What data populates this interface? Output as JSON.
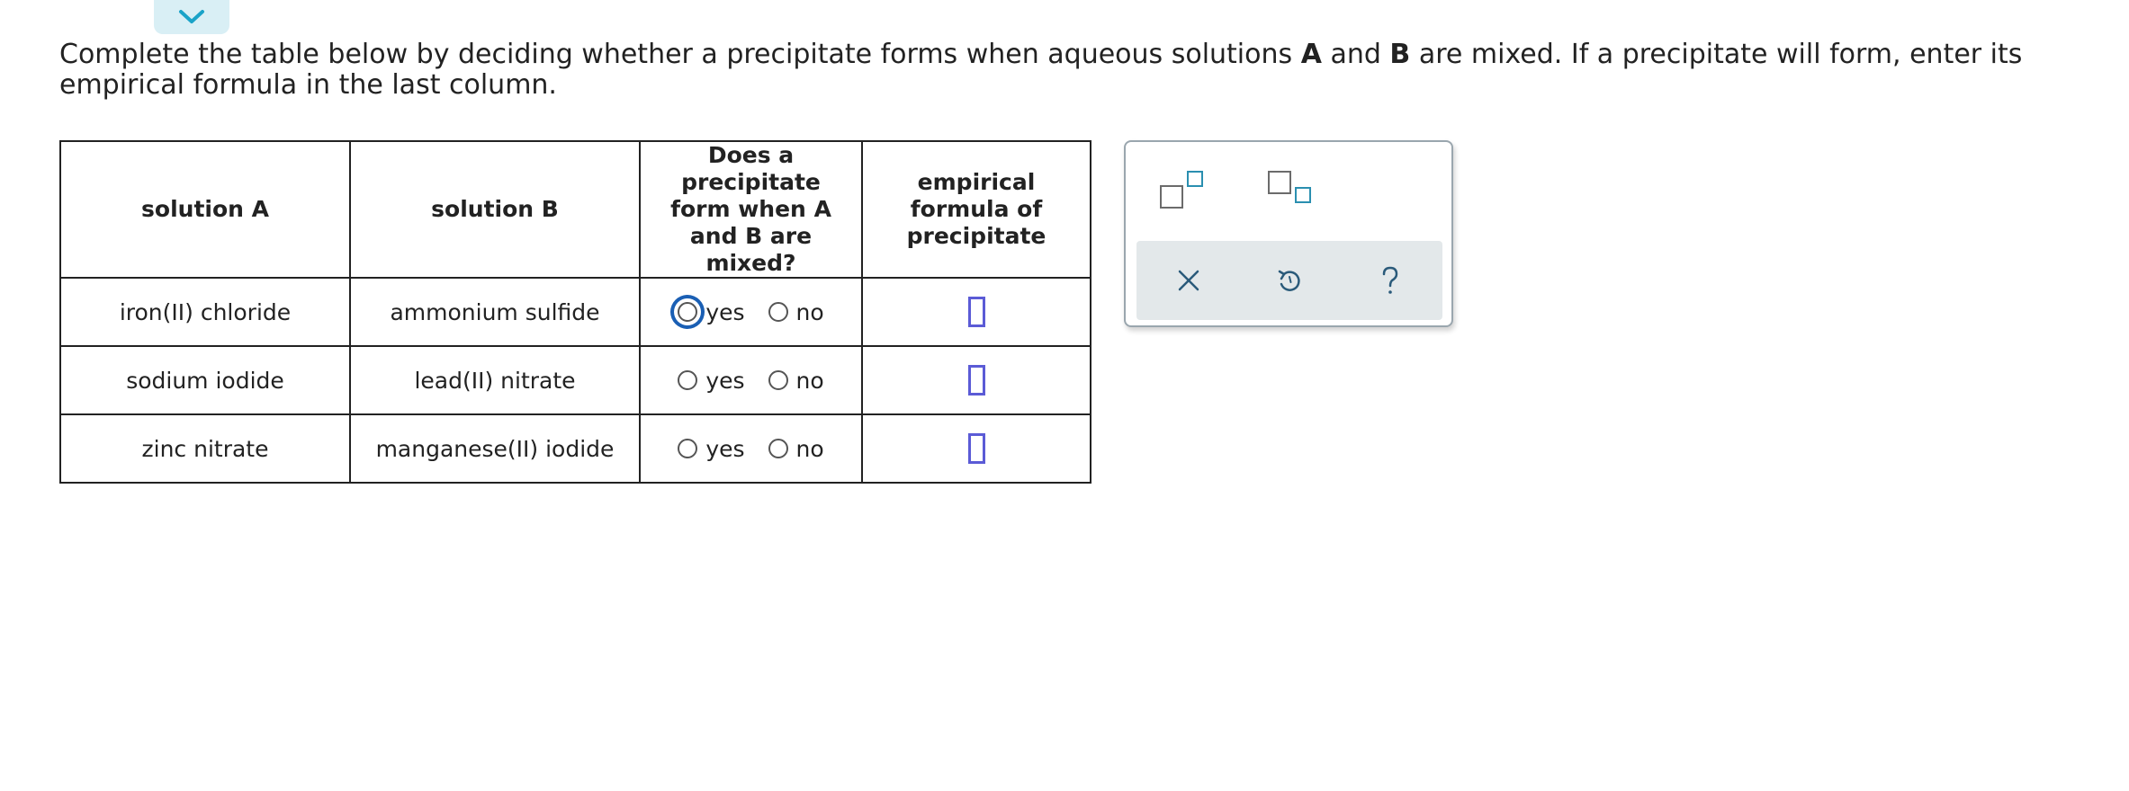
{
  "instructions": {
    "part1": "Complete the table below by deciding whether a precipitate forms when aqueous solutions ",
    "bold_a": "A",
    "part2": " and ",
    "bold_b": "B",
    "part3": " are mixed. If a precipitate will form, enter its empirical formula in the last column."
  },
  "table": {
    "headers": {
      "solution_a": "solution A",
      "solution_b": "solution B",
      "precipitate_q": "Does a precipitate form when A and B are mixed?",
      "formula": "empirical formula of precipitate"
    },
    "rows": [
      {
        "solution_a": "iron(II) chloride",
        "solution_b": "ammonium sulfide",
        "yes": "yes",
        "no": "no"
      },
      {
        "solution_a": "sodium iodide",
        "solution_b": "lead(II) nitrate",
        "yes": "yes",
        "no": "no"
      },
      {
        "solution_a": "zinc nitrate",
        "solution_b": "manganese(II) iodide",
        "yes": "yes",
        "no": "no"
      }
    ]
  },
  "palette": {
    "templates": [
      "superscript-template-icon",
      "subscript-template-icon"
    ],
    "actions": [
      "clear-icon",
      "undo-icon",
      "help-icon"
    ],
    "accent_color": "#2a8fb0"
  },
  "colors": {
    "tab_bg": "#d9eff5",
    "tab_chevron": "#1aa3c8",
    "answer_box": "#5b5bd6",
    "focus_ring": "#1a5fb4"
  }
}
